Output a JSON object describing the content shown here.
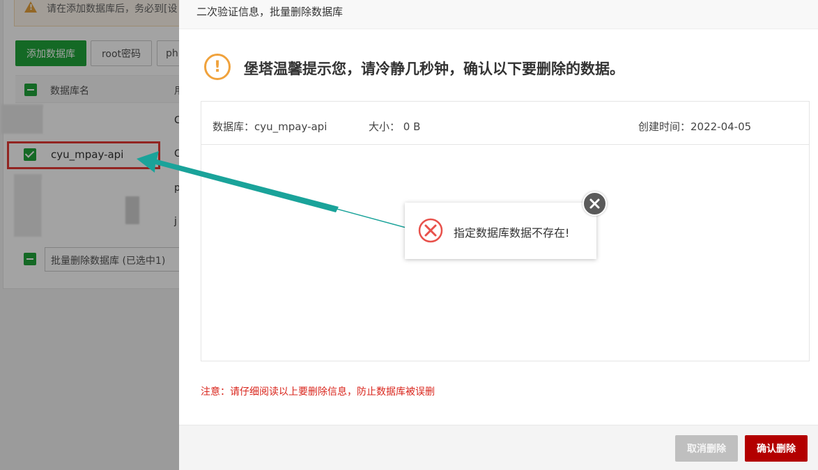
{
  "background": {
    "notice_text": "请在添加数据库后，务必到[设",
    "buttons": {
      "add_db": "添加数据库",
      "root_pwd": "root密码",
      "php": "ph"
    },
    "table": {
      "header_name": "数据库名",
      "header_next": "用",
      "rows": [
        {
          "name": "",
          "next": "C"
        },
        {
          "name": "cyu_mpay-api",
          "next": "C"
        },
        {
          "name": "",
          "next": "p"
        },
        {
          "name": "",
          "next": "j"
        }
      ]
    },
    "batch_select": "批量删除数据库 (已选中1)"
  },
  "dialog": {
    "title": "二次验证信息，批量删除数据库",
    "warning_text": "堡塔温馨提示您，请冷静几秒钟，确认以下要删除的数据。",
    "info": {
      "db_label": "数据库：cyu_mpay-api",
      "size_label": "大小：  0 B",
      "created_label": "创建时间：2022-04-05"
    },
    "notice": "注意：请仔细阅读以上要删除信息，防止数据库被误删",
    "cancel_button": "取消删除",
    "confirm_button": "确认删除"
  },
  "toast": {
    "message": "指定数据库数据不存在!"
  },
  "colors": {
    "primary_green": "#20a53a",
    "warning_orange": "#f0a23c",
    "danger_red": "#d9251c",
    "confirm_red": "#b30000",
    "annotation_red": "#e53935",
    "annotation_teal": "#1aa39a"
  }
}
